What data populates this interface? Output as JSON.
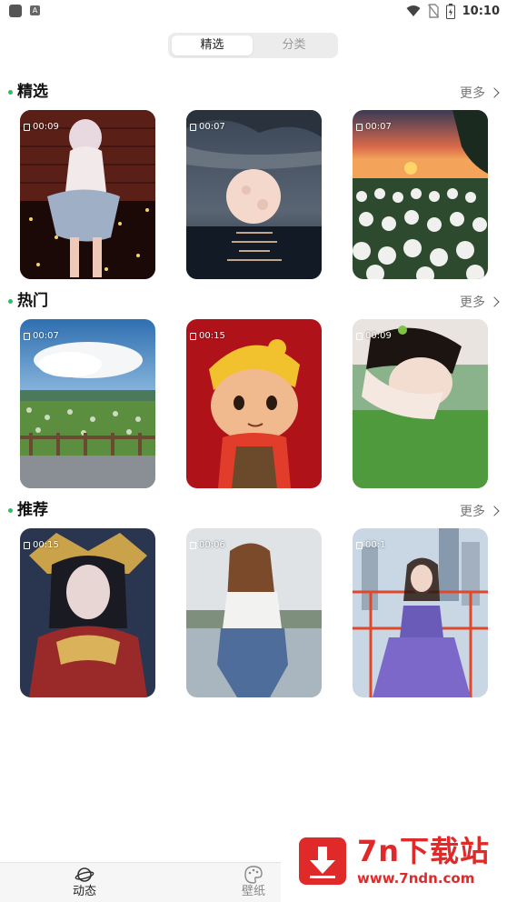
{
  "status_bar": {
    "time": "10:10"
  },
  "tabs": [
    {
      "label": "精选",
      "active": true
    },
    {
      "label": "分类",
      "active": false
    }
  ],
  "more_label": "更多",
  "sections": [
    {
      "title": "精选",
      "items": [
        {
          "duration": "00:09"
        },
        {
          "duration": "00:07"
        },
        {
          "duration": "00:07"
        }
      ]
    },
    {
      "title": "热门",
      "items": [
        {
          "duration": "00:07"
        },
        {
          "duration": "00:15"
        },
        {
          "duration": "00:09"
        }
      ]
    },
    {
      "title": "推荐",
      "items": [
        {
          "duration": "00:15"
        },
        {
          "duration": "00:06"
        },
        {
          "duration": "00:1"
        }
      ]
    }
  ],
  "bottom_nav": [
    {
      "label": "动态",
      "icon": "planet-icon",
      "active": true
    },
    {
      "label": "壁纸",
      "icon": "palette-icon",
      "active": false
    }
  ],
  "watermark": {
    "brand": "7n下载站",
    "url": "www.7ndn.com"
  },
  "colors": {
    "accent_dot": "#22c55e",
    "watermark": "#e02a2a"
  }
}
